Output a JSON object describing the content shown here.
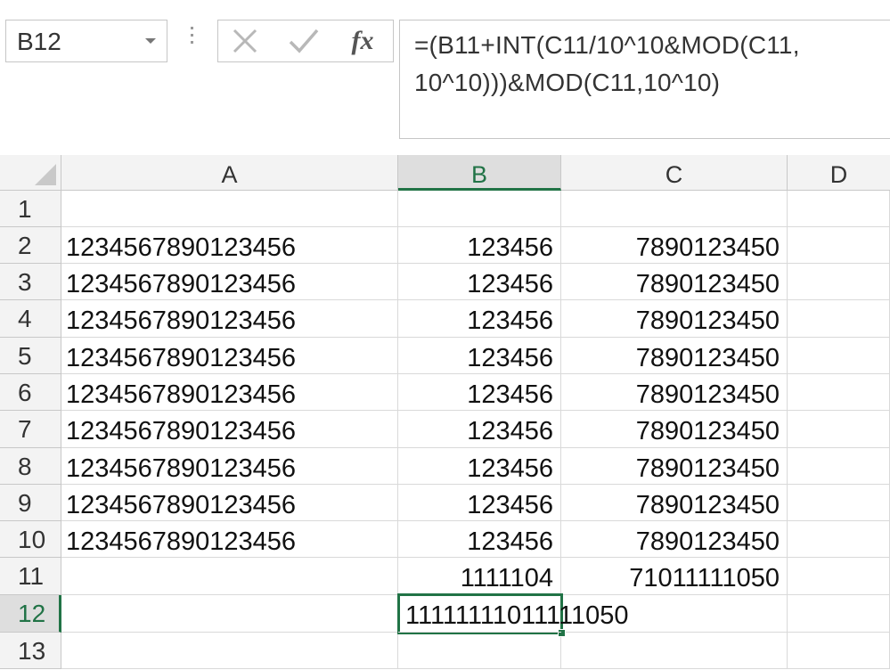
{
  "name_box": {
    "value": "B12"
  },
  "formula_bar": {
    "cancel_icon": "x-icon",
    "enter_icon": "checkmark-icon",
    "function_label": "fx",
    "lines": [
      "=(B11+INT(C11/10^10&MOD(C11,",
      "10^10)))&MOD(C11,10^10)"
    ]
  },
  "columns": [
    "A",
    "B",
    "C",
    "D"
  ],
  "active_column": "B",
  "rows": [
    {
      "num": "1",
      "A": "",
      "B": "",
      "C": ""
    },
    {
      "num": "2",
      "A": "1234567890123456",
      "B": "123456",
      "C": "7890123450"
    },
    {
      "num": "3",
      "A": "1234567890123456",
      "B": "123456",
      "C": "7890123450"
    },
    {
      "num": "4",
      "A": "1234567890123456",
      "B": "123456",
      "C": "7890123450"
    },
    {
      "num": "5",
      "A": "1234567890123456",
      "B": "123456",
      "C": "7890123450"
    },
    {
      "num": "6",
      "A": "1234567890123456",
      "B": "123456",
      "C": "7890123450"
    },
    {
      "num": "7",
      "A": "1234567890123456",
      "B": "123456",
      "C": "7890123450"
    },
    {
      "num": "8",
      "A": "1234567890123456",
      "B": "123456",
      "C": "7890123450"
    },
    {
      "num": "9",
      "A": "1234567890123456",
      "B": "123456",
      "C": "7890123450"
    },
    {
      "num": "10",
      "A": "1234567890123456",
      "B": "123456",
      "C": "7890123450"
    },
    {
      "num": "11",
      "A": "",
      "B": "1111104",
      "C": "71011111050"
    },
    {
      "num": "12",
      "A": "",
      "B": "11111111011111050",
      "C": ""
    },
    {
      "num": "13",
      "A": "",
      "B": "",
      "C": ""
    }
  ],
  "active_row": "12",
  "colors": {
    "accent": "#217346"
  }
}
